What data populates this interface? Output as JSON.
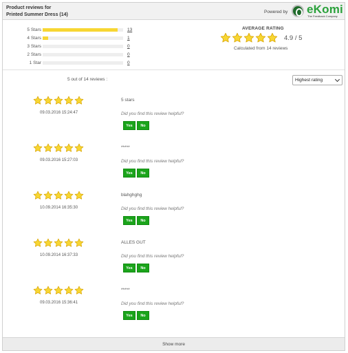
{
  "header": {
    "title_line1": "Product reviews for",
    "title_line2": "Printed Summer Dress (14)",
    "powered_by": "Powered by",
    "logo_text": "eKomi",
    "logo_tagline": "The Feedback Company"
  },
  "distribution": [
    {
      "label": "5 Stars",
      "count": "13",
      "fraction": 0.93
    },
    {
      "label": "4 Stars",
      "count": "1",
      "fraction": 0.07
    },
    {
      "label": "3 Stars",
      "count": "0",
      "fraction": 0
    },
    {
      "label": "2 Stars",
      "count": "0",
      "fraction": 0
    },
    {
      "label": "1 Star",
      "count": "0",
      "fraction": 0
    }
  ],
  "average": {
    "title": "AVERAGE RATING",
    "value": "4.9 / 5",
    "rating": 4.9,
    "calculated": "Calculated from 14 reviews"
  },
  "list": {
    "count_text": "5 out of 14 reviews :",
    "sort_selected": "Highest rating"
  },
  "reviews": [
    {
      "rating": 5,
      "date": "09.03.2016 15:24:47",
      "text": "5 stars",
      "helpful": "Did you find this review helpful?",
      "yes": "Yes",
      "no": "No"
    },
    {
      "rating": 5,
      "date": "09.03.2016 15:27:03",
      "text": "*****",
      "helpful": "Did you find this review helpful?",
      "yes": "Yes",
      "no": "No"
    },
    {
      "rating": 5,
      "date": "10.09.2014 16:35:30",
      "text": "blahghghg",
      "helpful": "Did you find this review helpful?",
      "yes": "Yes",
      "no": "No"
    },
    {
      "rating": 5,
      "date": "10.09.2014 16:37:33",
      "text": "ALLES GUT",
      "helpful": "Did you find this review helpful?",
      "yes": "Yes",
      "no": "No"
    },
    {
      "rating": 5,
      "date": "09.03.2016 15:36:41",
      "text": "*****",
      "helpful": "Did you find this review helpful?",
      "yes": "Yes",
      "no": "No"
    }
  ],
  "footer": {
    "show_more": "Show more"
  },
  "colors": {
    "star": "#f7d633",
    "star_stroke": "#d9a400",
    "button": "#1ba41b",
    "brand": "#2aa13b"
  }
}
